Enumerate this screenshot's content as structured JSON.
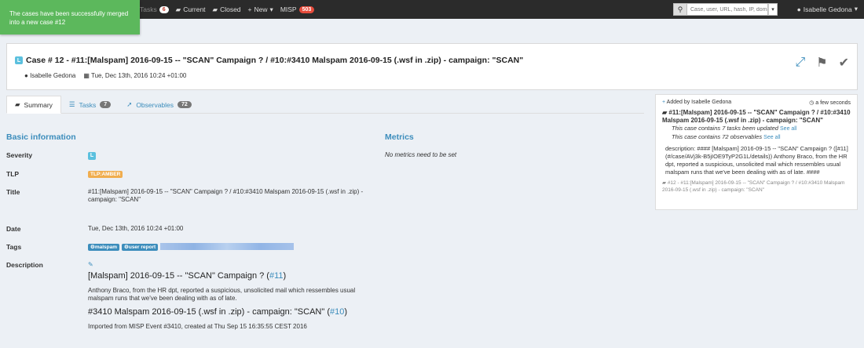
{
  "topbar": {
    "tasks_label": "Tasks",
    "tasks_count": "6",
    "current_label": "Current",
    "closed_label": "Closed",
    "new_label": "New",
    "misp_label": "MISP",
    "misp_count": "503",
    "search_placeholder": "Case, user, URL, hash, IP, domain ...",
    "user_name": "Isabelle Gedona"
  },
  "toast": {
    "message": "The cases have been successfully merged into a new case #12"
  },
  "case": {
    "severity": "L",
    "title": "Case # 12 - #11:[Malspam] 2016-09-15 -- \"SCAN\" Campaign ? / #10:#3410 Malspam 2016-09-15 (.wsf in .zip) - campaign: \"SCAN\"",
    "owner": "Isabelle Gedona",
    "date": "Tue, Dec 13th, 2016 10:24 +01:00"
  },
  "tabs": [
    {
      "label": "Summary"
    },
    {
      "label": "Tasks",
      "count": "7"
    },
    {
      "label": "Observables",
      "count": "72"
    }
  ],
  "basic": {
    "heading": "Basic information",
    "severity_label": "Severity",
    "severity_value": "L",
    "tlp_label": "TLP",
    "tlp_value": "TLP:AMBER",
    "title_label": "Title",
    "title_value": "#11:[Malspam] 2016-09-15 -- \"SCAN\" Campaign ? / #10:#3410 Malspam 2016-09-15 (.wsf in .zip) - campaign: \"SCAN\"",
    "date_label": "Date",
    "date_value": "Tue, Dec 13th, 2016 10:24 +01:00",
    "tags_label": "Tags",
    "tags": [
      "malspam",
      "user report"
    ],
    "description_label": "Description",
    "desc_h1": "[Malspam] 2016-09-15 -- \"SCAN\" Campaign ? (",
    "desc_h1_link": "#11",
    "desc_p1": "Anthony Braco, from the HR dpt, reported a suspicious, unsolicited mail which ressembles usual malspam runs that we've been dealing with as of late.",
    "desc_h2": "#3410 Malspam 2016-09-15 (.wsf in .zip) - campaign: \"SCAN\" (",
    "desc_h2_link": "#10",
    "desc_p2": "Imported from MISP Event #3410, created at Thu Sep 15 16:35:55 CEST 2016"
  },
  "metrics": {
    "heading": "Metrics",
    "empty": "No metrics need to be set"
  },
  "activity": {
    "added_by": "Added by Isabelle Gedona",
    "time": "a few seconds",
    "case_title": "#11:[Malspam] 2016-09-15 -- \"SCAN\" Campaign ? / #10:#3410 Malspam 2016-09-15 (.wsf in .zip) - campaign: \"SCAN\"",
    "tasks_line": "This case contains 7 tasks been updated",
    "obs_line": "This case contains 72 observables",
    "see_all": "See all",
    "description": "description: #### [Malspam] 2016-09-15 -- \"SCAN\" Campaign ? ([#11](#/case/AVj3k-B5jIOE9TyP2G1L/details)) Anthony Braco, from the HR dpt, reported a suspicious, unsolicited mail which ressembles usual malspam runs that we've been dealing with as of late. ####",
    "footer": "#12 - #11:[Malspam] 2016-09-15 -- \"SCAN\" Campaign ? / #10:#3410 Malspam 2016-09-15 (.wsf in .zip) - campaign: \"SCAN\""
  }
}
